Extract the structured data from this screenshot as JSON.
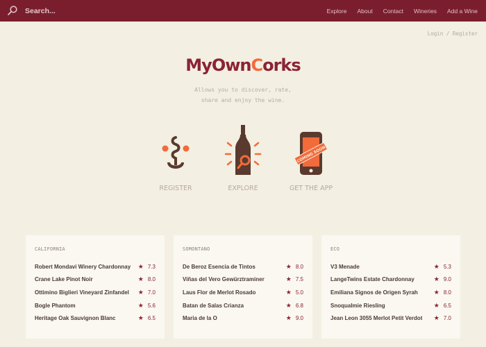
{
  "header": {
    "search_placeholder": "Search...",
    "nav": [
      "Explore",
      "About",
      "Contact",
      "Wineries",
      "Add a Wine"
    ]
  },
  "auth": {
    "login": "Login",
    "separator": "/",
    "register": "Register"
  },
  "brand": {
    "logo_part1": "MyOwn",
    "logo_cork": "C",
    "logo_part2": "orks"
  },
  "tagline": {
    "line1": "Allows you to discover, rate,",
    "line2": "share and enjoy the wine."
  },
  "features": {
    "register": {
      "label": "REGISTER",
      "icon": "corkscrew-icon"
    },
    "explore": {
      "label": "EXPLORE",
      "icon": "bottle-magnifier-icon"
    },
    "app": {
      "label": "GET THE APP",
      "icon": "phone-icon",
      "badge": "COMING SOON"
    }
  },
  "colors": {
    "brand": "#7a1e2e",
    "accent": "#f26b3a",
    "background": "#f3efe2"
  },
  "lists": [
    {
      "region": "CALIFORNIA",
      "wines": [
        {
          "name": "Robert Mondavi Winery Chardonnay",
          "score": "7.3"
        },
        {
          "name": "Crane Lake Pinot Noir",
          "score": "8.0"
        },
        {
          "name": "Ottimino Biglieri Vineyard Zinfandel",
          "score": "7.0"
        },
        {
          "name": "Bogle Phantom",
          "score": "5.6"
        },
        {
          "name": "Heritage Oak Sauvignon Blanc",
          "score": "6.5"
        }
      ]
    },
    {
      "region": "SOMONTANO",
      "wines": [
        {
          "name": "De Beroz Esencia de Tintos",
          "score": "8.0"
        },
        {
          "name": "Viñas del Vero Gewürztraminer",
          "score": "7.5"
        },
        {
          "name": "Laus Flor de Merlot Rosado",
          "score": "5.0"
        },
        {
          "name": "Batan de Salas Crianza",
          "score": "6.8"
        },
        {
          "name": "Maria de la O",
          "score": "9.0"
        }
      ]
    },
    {
      "region": "ECO",
      "wines": [
        {
          "name": "V3 Menade",
          "score": "5.3"
        },
        {
          "name": "LangeTwins Estate Chardonnay",
          "score": "9.0"
        },
        {
          "name": "Emiliana Signos de Origen Syrah",
          "score": "8.0"
        },
        {
          "name": "Snoqualmie Riesling",
          "score": "6.5"
        },
        {
          "name": "Jean Leon 3055 Merlot Petit Verdot",
          "score": "7.0"
        }
      ]
    }
  ]
}
